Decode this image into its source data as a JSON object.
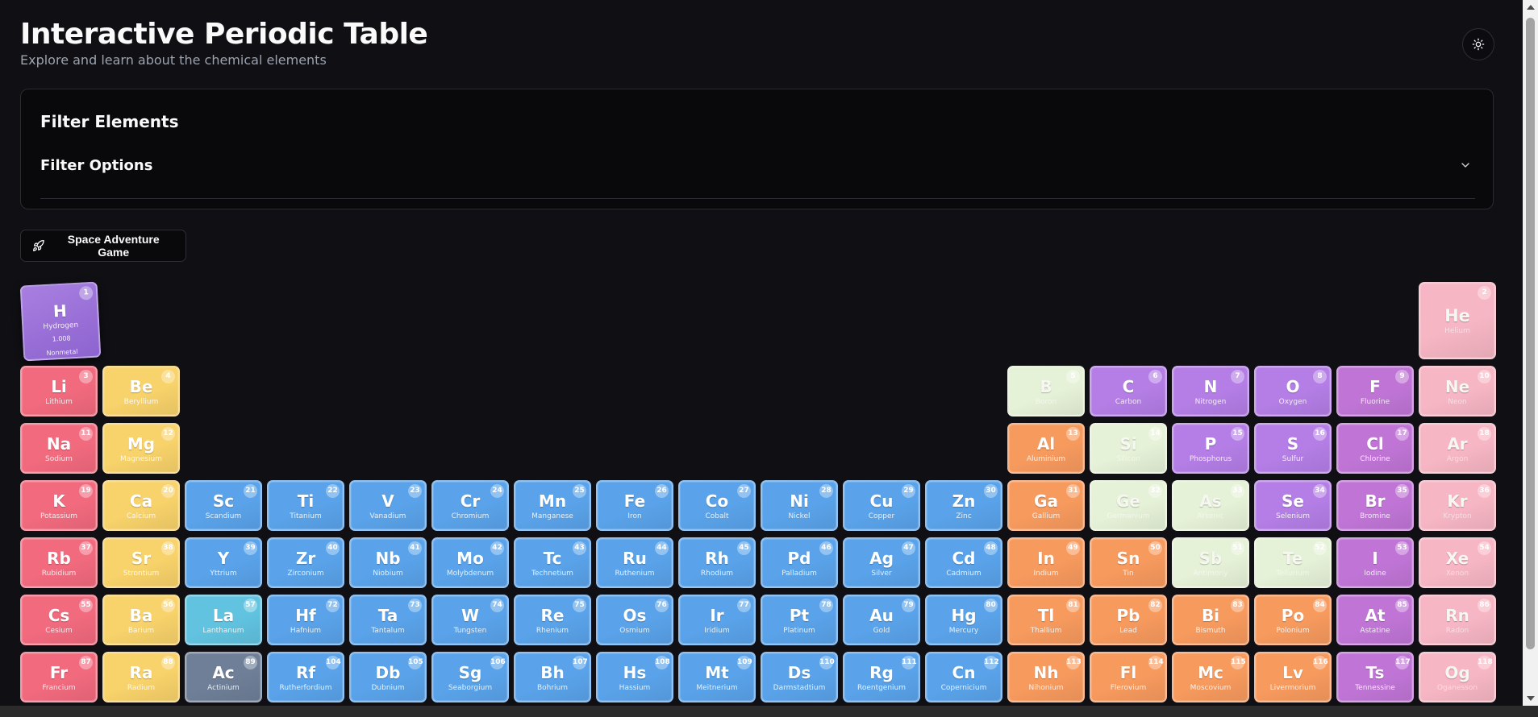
{
  "header": {
    "title": "Interactive Periodic Table",
    "subtitle": "Explore and learn about the chemical elements"
  },
  "theme_toggle": {
    "icon": "sun-icon"
  },
  "filter": {
    "heading": "Filter Elements",
    "options_label": "Filter Options",
    "chevron_icon": "chevron-down-icon"
  },
  "game_button": {
    "label": "Space Adventure Game",
    "icon": "rocket-icon"
  },
  "featured": {
    "symbol": "H",
    "name": "Hydrogen",
    "number": "1",
    "mass": "1.008",
    "category": "Nonmetal"
  },
  "colors": {
    "alkali": "#f26a7e",
    "alkaline": "#f8d26a",
    "transition": "#5aa3ea",
    "lanthanide": "#61c3e0",
    "actinide": "#6e7f97",
    "post_transition": "#f79a5e",
    "metalloid": "#e6f2d8",
    "nonmetal": "#b47ee6",
    "halogen": "#c075d6",
    "noble": "#f7b6c4",
    "hydrogen": "#a87fe0"
  },
  "elements": [
    {
      "n": "2",
      "s": "He",
      "name": "Helium",
      "c": "noble"
    },
    {
      "n": "3",
      "s": "Li",
      "name": "Lithium",
      "c": "alkali"
    },
    {
      "n": "4",
      "s": "Be",
      "name": "Beryllium",
      "c": "alkaline"
    },
    {
      "n": "5",
      "s": "B",
      "name": "Boron",
      "c": "metalloid"
    },
    {
      "n": "6",
      "s": "C",
      "name": "Carbon",
      "c": "nonmetal"
    },
    {
      "n": "7",
      "s": "N",
      "name": "Nitrogen",
      "c": "nonmetal"
    },
    {
      "n": "8",
      "s": "O",
      "name": "Oxygen",
      "c": "nonmetal"
    },
    {
      "n": "9",
      "s": "F",
      "name": "Fluorine",
      "c": "halogen"
    },
    {
      "n": "10",
      "s": "Ne",
      "name": "Neon",
      "c": "noble"
    },
    {
      "n": "11",
      "s": "Na",
      "name": "Sodium",
      "c": "alkali"
    },
    {
      "n": "12",
      "s": "Mg",
      "name": "Magnesium",
      "c": "alkaline"
    },
    {
      "n": "13",
      "s": "Al",
      "name": "Aluminium",
      "c": "post_transition"
    },
    {
      "n": "14",
      "s": "Si",
      "name": "Silicon",
      "c": "metalloid"
    },
    {
      "n": "15",
      "s": "P",
      "name": "Phosphorus",
      "c": "nonmetal"
    },
    {
      "n": "16",
      "s": "S",
      "name": "Sulfur",
      "c": "nonmetal"
    },
    {
      "n": "17",
      "s": "Cl",
      "name": "Chlorine",
      "c": "halogen"
    },
    {
      "n": "18",
      "s": "Ar",
      "name": "Argon",
      "c": "noble"
    },
    {
      "n": "19",
      "s": "K",
      "name": "Potassium",
      "c": "alkali"
    },
    {
      "n": "20",
      "s": "Ca",
      "name": "Calcium",
      "c": "alkaline"
    },
    {
      "n": "21",
      "s": "Sc",
      "name": "Scandium",
      "c": "transition"
    },
    {
      "n": "22",
      "s": "Ti",
      "name": "Titanium",
      "c": "transition"
    },
    {
      "n": "23",
      "s": "V",
      "name": "Vanadium",
      "c": "transition"
    },
    {
      "n": "24",
      "s": "Cr",
      "name": "Chromium",
      "c": "transition"
    },
    {
      "n": "25",
      "s": "Mn",
      "name": "Manganese",
      "c": "transition"
    },
    {
      "n": "26",
      "s": "Fe",
      "name": "Iron",
      "c": "transition"
    },
    {
      "n": "27",
      "s": "Co",
      "name": "Cobalt",
      "c": "transition"
    },
    {
      "n": "28",
      "s": "Ni",
      "name": "Nickel",
      "c": "transition"
    },
    {
      "n": "29",
      "s": "Cu",
      "name": "Copper",
      "c": "transition"
    },
    {
      "n": "30",
      "s": "Zn",
      "name": "Zinc",
      "c": "transition"
    },
    {
      "n": "31",
      "s": "Ga",
      "name": "Gallium",
      "c": "post_transition"
    },
    {
      "n": "32",
      "s": "Ge",
      "name": "Germanium",
      "c": "metalloid"
    },
    {
      "n": "33",
      "s": "As",
      "name": "Arsenic",
      "c": "metalloid"
    },
    {
      "n": "34",
      "s": "Se",
      "name": "Selenium",
      "c": "nonmetal"
    },
    {
      "n": "35",
      "s": "Br",
      "name": "Bromine",
      "c": "halogen"
    },
    {
      "n": "36",
      "s": "Kr",
      "name": "Krypton",
      "c": "noble"
    },
    {
      "n": "37",
      "s": "Rb",
      "name": "Rubidium",
      "c": "alkali"
    },
    {
      "n": "38",
      "s": "Sr",
      "name": "Strontium",
      "c": "alkaline"
    },
    {
      "n": "39",
      "s": "Y",
      "name": "Yttrium",
      "c": "transition"
    },
    {
      "n": "40",
      "s": "Zr",
      "name": "Zirconium",
      "c": "transition"
    },
    {
      "n": "41",
      "s": "Nb",
      "name": "Niobium",
      "c": "transition"
    },
    {
      "n": "42",
      "s": "Mo",
      "name": "Molybdenum",
      "c": "transition"
    },
    {
      "n": "43",
      "s": "Tc",
      "name": "Technetium",
      "c": "transition"
    },
    {
      "n": "44",
      "s": "Ru",
      "name": "Ruthenium",
      "c": "transition"
    },
    {
      "n": "45",
      "s": "Rh",
      "name": "Rhodium",
      "c": "transition"
    },
    {
      "n": "46",
      "s": "Pd",
      "name": "Palladium",
      "c": "transition"
    },
    {
      "n": "47",
      "s": "Ag",
      "name": "Silver",
      "c": "transition"
    },
    {
      "n": "48",
      "s": "Cd",
      "name": "Cadmium",
      "c": "transition"
    },
    {
      "n": "49",
      "s": "In",
      "name": "Indium",
      "c": "post_transition"
    },
    {
      "n": "50",
      "s": "Sn",
      "name": "Tin",
      "c": "post_transition"
    },
    {
      "n": "51",
      "s": "Sb",
      "name": "Antimony",
      "c": "metalloid"
    },
    {
      "n": "52",
      "s": "Te",
      "name": "Tellurium",
      "c": "metalloid"
    },
    {
      "n": "53",
      "s": "I",
      "name": "Iodine",
      "c": "halogen"
    },
    {
      "n": "54",
      "s": "Xe",
      "name": "Xenon",
      "c": "noble"
    },
    {
      "n": "55",
      "s": "Cs",
      "name": "Cesium",
      "c": "alkali"
    },
    {
      "n": "56",
      "s": "Ba",
      "name": "Barium",
      "c": "alkaline"
    },
    {
      "n": "57",
      "s": "La",
      "name": "Lanthanum",
      "c": "lanthanide"
    },
    {
      "n": "72",
      "s": "Hf",
      "name": "Hafnium",
      "c": "transition"
    },
    {
      "n": "73",
      "s": "Ta",
      "name": "Tantalum",
      "c": "transition"
    },
    {
      "n": "74",
      "s": "W",
      "name": "Tungsten",
      "c": "transition"
    },
    {
      "n": "75",
      "s": "Re",
      "name": "Rhenium",
      "c": "transition"
    },
    {
      "n": "76",
      "s": "Os",
      "name": "Osmium",
      "c": "transition"
    },
    {
      "n": "77",
      "s": "Ir",
      "name": "Iridium",
      "c": "transition"
    },
    {
      "n": "78",
      "s": "Pt",
      "name": "Platinum",
      "c": "transition"
    },
    {
      "n": "79",
      "s": "Au",
      "name": "Gold",
      "c": "transition"
    },
    {
      "n": "80",
      "s": "Hg",
      "name": "Mercury",
      "c": "transition"
    },
    {
      "n": "81",
      "s": "Tl",
      "name": "Thallium",
      "c": "post_transition"
    },
    {
      "n": "82",
      "s": "Pb",
      "name": "Lead",
      "c": "post_transition"
    },
    {
      "n": "83",
      "s": "Bi",
      "name": "Bismuth",
      "c": "post_transition"
    },
    {
      "n": "84",
      "s": "Po",
      "name": "Polonium",
      "c": "post_transition"
    },
    {
      "n": "85",
      "s": "At",
      "name": "Astatine",
      "c": "halogen"
    },
    {
      "n": "86",
      "s": "Rn",
      "name": "Radon",
      "c": "noble"
    },
    {
      "n": "87",
      "s": "Fr",
      "name": "Francium",
      "c": "alkali"
    },
    {
      "n": "88",
      "s": "Ra",
      "name": "Radium",
      "c": "alkaline"
    },
    {
      "n": "89",
      "s": "Ac",
      "name": "Actinium",
      "c": "actinide"
    },
    {
      "n": "104",
      "s": "Rf",
      "name": "Rutherfordium",
      "c": "transition"
    },
    {
      "n": "105",
      "s": "Db",
      "name": "Dubnium",
      "c": "transition"
    },
    {
      "n": "106",
      "s": "Sg",
      "name": "Seaborgium",
      "c": "transition"
    },
    {
      "n": "107",
      "s": "Bh",
      "name": "Bohrium",
      "c": "transition"
    },
    {
      "n": "108",
      "s": "Hs",
      "name": "Hassium",
      "c": "transition"
    },
    {
      "n": "109",
      "s": "Mt",
      "name": "Meitnerium",
      "c": "transition"
    },
    {
      "n": "110",
      "s": "Ds",
      "name": "Darmstadtium",
      "c": "transition"
    },
    {
      "n": "111",
      "s": "Rg",
      "name": "Roentgenium",
      "c": "transition"
    },
    {
      "n": "112",
      "s": "Cn",
      "name": "Copernicium",
      "c": "transition"
    },
    {
      "n": "113",
      "s": "Nh",
      "name": "Nihonium",
      "c": "post_transition"
    },
    {
      "n": "114",
      "s": "Fl",
      "name": "Flerovium",
      "c": "post_transition"
    },
    {
      "n": "115",
      "s": "Mc",
      "name": "Moscovium",
      "c": "post_transition"
    },
    {
      "n": "116",
      "s": "Lv",
      "name": "Livermorium",
      "c": "post_transition"
    },
    {
      "n": "117",
      "s": "Ts",
      "name": "Tennessine",
      "c": "halogen"
    },
    {
      "n": "118",
      "s": "Og",
      "name": "Oganesson",
      "c": "noble"
    }
  ]
}
